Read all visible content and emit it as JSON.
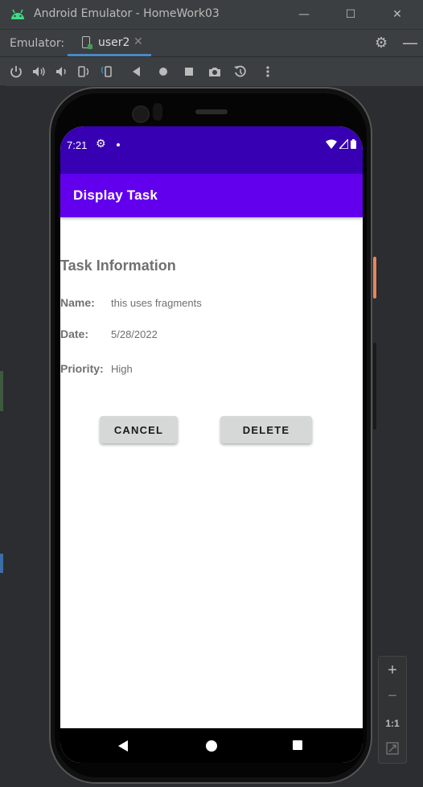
{
  "window": {
    "title": "Android Emulator - HomeWork03",
    "minimize": "—",
    "maximize": "☐",
    "close": "✕"
  },
  "tabs": {
    "emulator_label": "Emulator:",
    "device_tab": "user2",
    "tab_close": "✕"
  },
  "toolbar": {
    "icons": [
      "power-icon",
      "volume-up-icon",
      "volume-down-icon",
      "rotate-left-icon",
      "rotate-right-icon",
      "back-icon",
      "home-icon",
      "overview-icon",
      "camera-icon",
      "snapshot-icon",
      "more-icon"
    ]
  },
  "status_bar": {
    "time": "7:21"
  },
  "app_bar": {
    "title": "Display Task"
  },
  "task": {
    "heading": "Task Information",
    "name_label": "Name:",
    "name_value": "this uses fragments",
    "date_label": "Date:",
    "date_value": "5/28/2022",
    "priority_label": "Priority:",
    "priority_value": "High"
  },
  "buttons": {
    "cancel": "CANCEL",
    "delete": "DELETE"
  },
  "zoom": {
    "zoom_in": "+",
    "zoom_out": "−",
    "actual_size": "1:1"
  },
  "colors": {
    "status_bar": "#3700b3",
    "app_bar": "#6200ee",
    "button": "#d6d7d7",
    "text": "#707070",
    "tab_accent": "#4a88c7",
    "side_button": "#e8855b"
  }
}
